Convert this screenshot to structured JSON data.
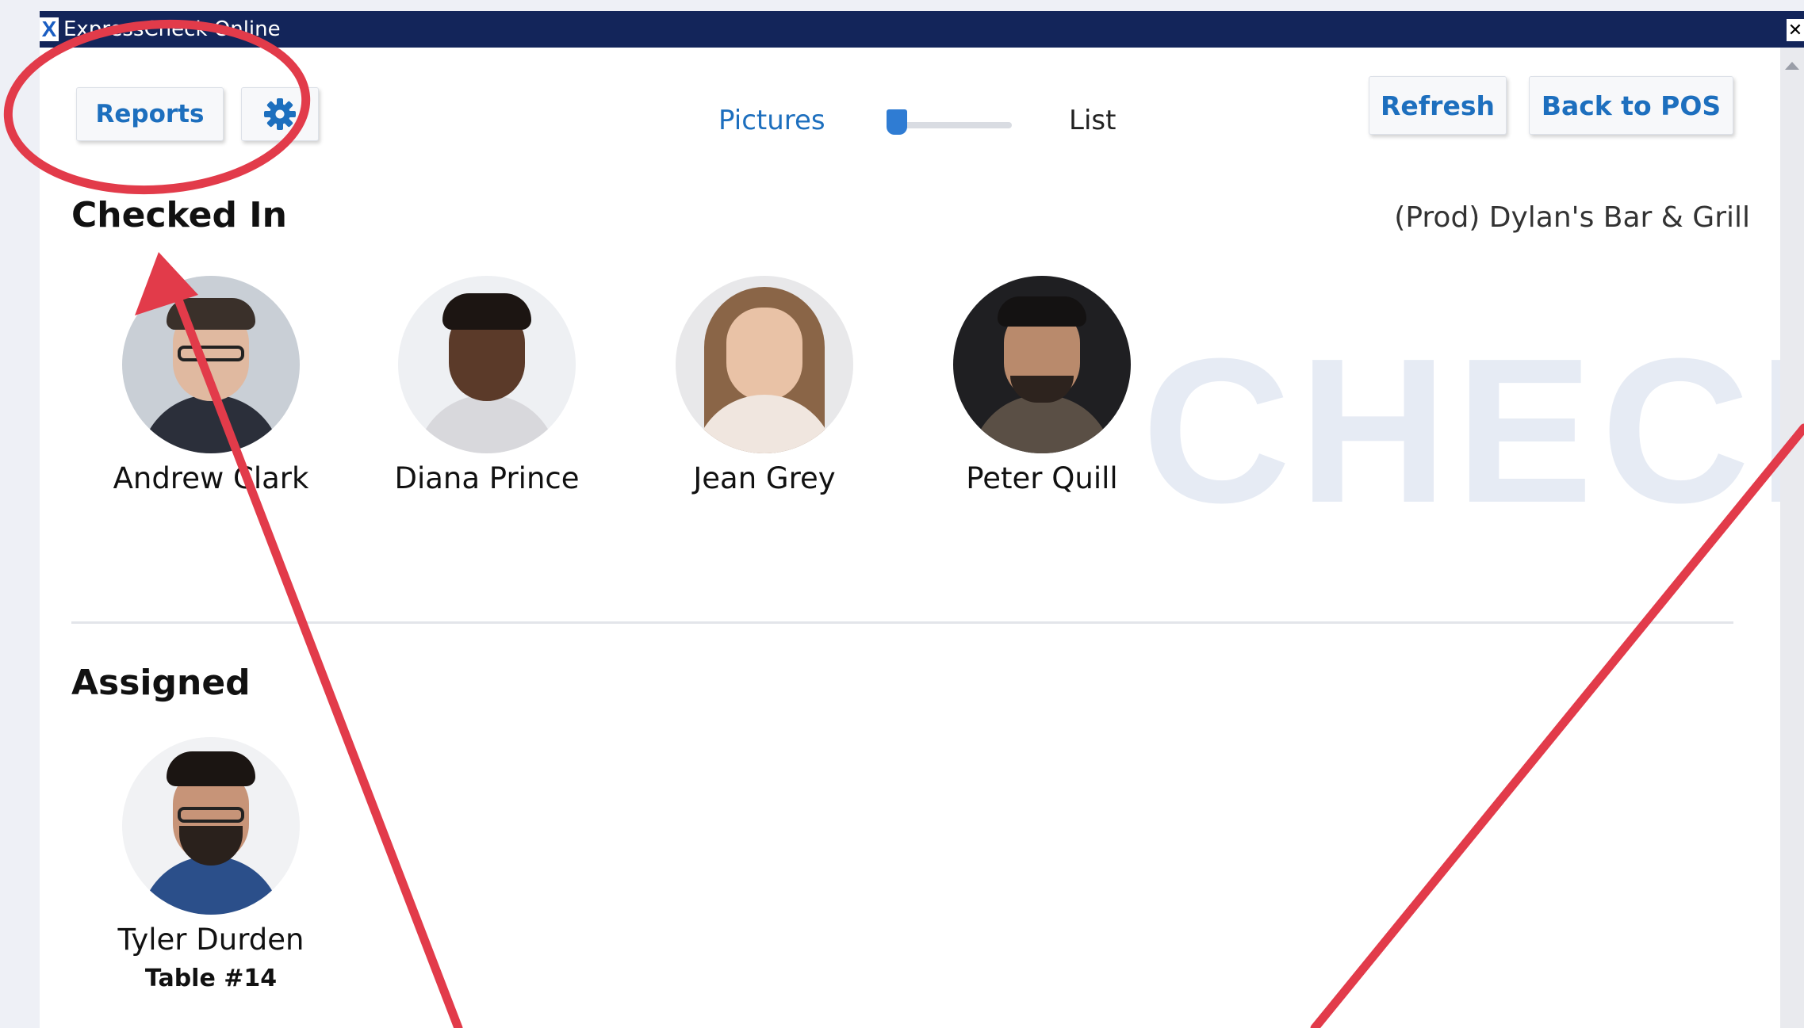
{
  "window": {
    "title": "ExpressCheck Online",
    "app_icon": "X",
    "close_icon": "✕"
  },
  "toolbar": {
    "reports_label": "Reports",
    "settings_icon": "gear-icon",
    "view_toggle": {
      "left_label": "Pictures",
      "right_label": "List",
      "selected": "Pictures"
    },
    "refresh_label": "Refresh",
    "back_label": "Back to POS"
  },
  "location": "(Prod) Dylan's Bar & Grill",
  "watermark": "CHECK",
  "checked_in": {
    "title": "Checked In",
    "people": [
      {
        "name": "Andrew Clark"
      },
      {
        "name": "Diana Prince"
      },
      {
        "name": "Jean Grey"
      },
      {
        "name": "Peter Quill"
      }
    ]
  },
  "assigned": {
    "title": "Assigned",
    "people": [
      {
        "name": "Tyler Durden",
        "table": "Table #14"
      }
    ]
  },
  "colors": {
    "accent": "#1d6fbe",
    "titlebar": "#13255a",
    "annotation": "#e23b4a"
  }
}
